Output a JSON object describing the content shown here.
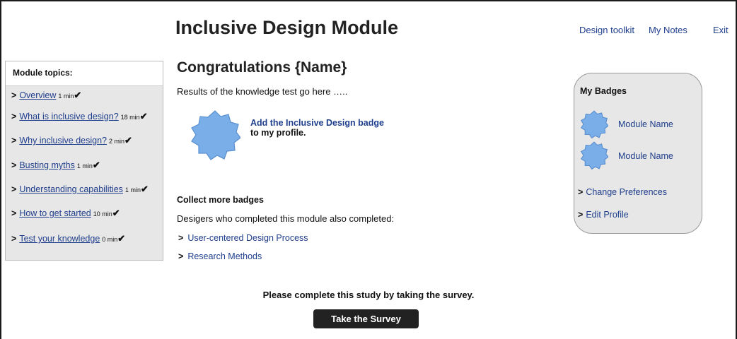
{
  "header": {
    "title": "Inclusive Design Module",
    "links": [
      "Design toolkit",
      "My Notes",
      "Exit"
    ]
  },
  "sidebar": {
    "heading": "Module topics:",
    "items": [
      {
        "label": "Overview",
        "time": "1 min",
        "check": "✔"
      },
      {
        "label": "What is inclusive design?",
        "time": "18 min",
        "check": "✔"
      },
      {
        "label": "Why inclusive design?",
        "time": "2 min",
        "check": "✔"
      },
      {
        "label": "Busting myths",
        "time": "1 min",
        "check": "✔"
      },
      {
        "label": "Understanding capabilities",
        "time": "1 min",
        "check": "✔"
      },
      {
        "label": "How to get started",
        "time": "10 min",
        "check": "✔"
      },
      {
        "label": "Test your knowledge",
        "time": "0 min",
        "check": "✔"
      }
    ],
    "arrow": ">"
  },
  "main": {
    "heading": "Congratulations {Name}",
    "results": "Results of the knowledge test go here …..",
    "add_badge_link": "Add the Inclusive Design badge",
    "add_badge_suffix": "to my profile.",
    "collect_heading": "Collect more badges",
    "also_completed": "Desigers who completed this module also completed:",
    "related": [
      "User-centered Design Process",
      "Research Methods"
    ]
  },
  "badges_panel": {
    "heading": "My Badges",
    "badges": [
      "Module Name",
      "Module Name"
    ],
    "links": [
      "Change Preferences",
      "Edit Profile"
    ]
  },
  "footer": {
    "prompt": "Please complete this study by taking the survey.",
    "button": "Take the Survey"
  },
  "colors": {
    "link": "#1f3e8c",
    "badge": "#7aaee8",
    "panel": "#e7e7e7",
    "button": "#222222"
  }
}
